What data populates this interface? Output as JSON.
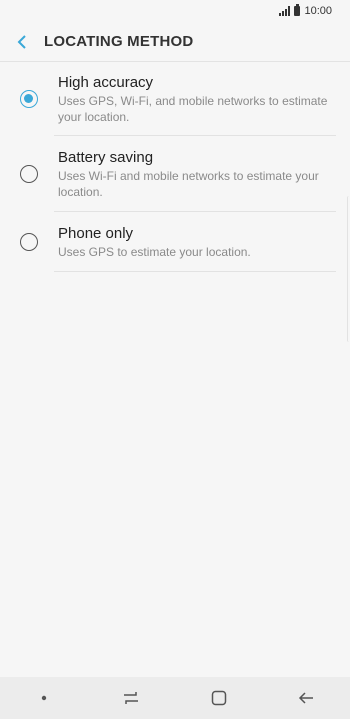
{
  "status_bar": {
    "time": "10:00"
  },
  "header": {
    "title": "LOCATING METHOD"
  },
  "options": [
    {
      "title": "High accuracy",
      "description": "Uses GPS, Wi-Fi, and mobile networks to estimate your location.",
      "selected": true
    },
    {
      "title": "Battery saving",
      "description": "Uses Wi-Fi and mobile networks to estimate your location.",
      "selected": false
    },
    {
      "title": "Phone only",
      "description": "Uses GPS to estimate your location.",
      "selected": false
    }
  ],
  "colors": {
    "accent": "#3aa8d8",
    "background": "#f6f6f6",
    "nav_bar": "#ececec"
  },
  "icons": {
    "back": "chevron-left-icon",
    "nav_dot": "dot-icon",
    "recents": "recents-icon",
    "home": "home-icon",
    "nav_back": "back-arrow-icon"
  }
}
